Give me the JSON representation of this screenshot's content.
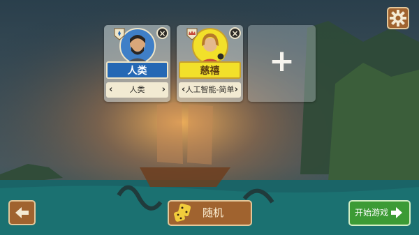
{
  "players": [
    {
      "name": "人类",
      "type": "人类",
      "color": "#2568b4",
      "portrait": "bearded-man-portrait"
    },
    {
      "name": "慈禧",
      "type": "人工智能-简单",
      "color": "#f2e02a",
      "portrait": "queen-portrait"
    }
  ],
  "add_slot": {
    "label": "+"
  },
  "buttons": {
    "random": "随机",
    "start": "开始游戏"
  },
  "icons": [
    "settings-gear-icon",
    "back-arrow-icon",
    "dice-icon",
    "forward-arrow-icon",
    "close-icon",
    "fleur-de-lis-icon",
    "crown-icon"
  ],
  "colors": {
    "button_wood": "#a0632f",
    "start_green": "#3c9b35",
    "accent_gold": "#e3c79a"
  }
}
